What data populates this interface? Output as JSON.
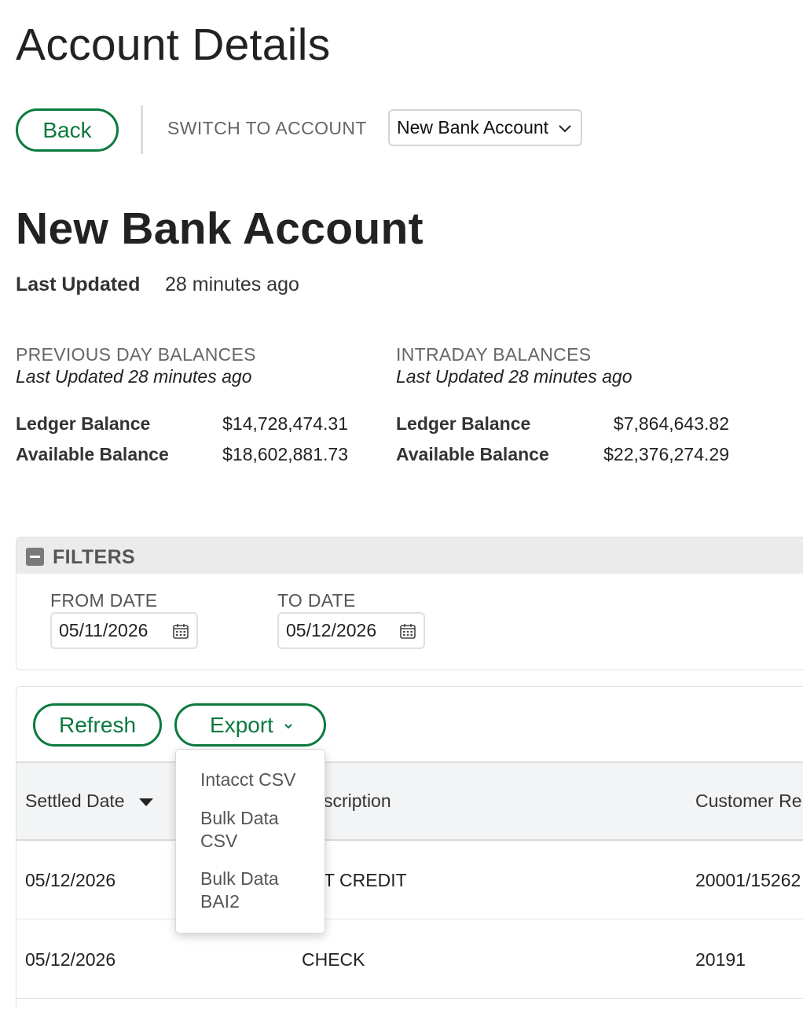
{
  "page": {
    "title": "Account Details"
  },
  "toolbar": {
    "back_label": "Back",
    "switch_label": "SWITCH TO ACCOUNT",
    "account_select_value": "New Bank Account"
  },
  "account": {
    "name": "New Bank Account",
    "last_updated_label": "Last Updated",
    "last_updated_value": "28 minutes ago"
  },
  "balances": {
    "previous": {
      "heading": "PREVIOUS DAY BALANCES",
      "sub": "Last Updated 28 minutes ago",
      "ledger_label": "Ledger Balance",
      "ledger_value": "$14,728,474.31",
      "available_label": "Available Balance",
      "available_value": "$18,602,881.73"
    },
    "intraday": {
      "heading": "INTRADAY BALANCES",
      "sub": "Last Updated 28 minutes ago",
      "ledger_label": "Ledger Balance",
      "ledger_value": "$7,864,643.82",
      "available_label": "Available Balance",
      "available_value": "$22,376,274.29"
    }
  },
  "filters": {
    "title": "FILTERS",
    "from_label": "FROM DATE",
    "from_value": "05/11/2026",
    "to_label": "TO DATE",
    "to_value": "05/12/2026"
  },
  "actions": {
    "refresh_label": "Refresh",
    "export_label": "Export",
    "export_menu": [
      "Intacct CSV",
      "Bulk Data CSV",
      "Bulk Data BAI2"
    ]
  },
  "table": {
    "columns": [
      "Settled Date",
      "scription",
      "Customer Re"
    ],
    "rows": [
      {
        "date": "05/12/2026",
        "description": "T CREDIT",
        "customer_ref": "20001/15262"
      },
      {
        "date": "05/12/2026",
        "description": "CHECK",
        "customer_ref": "20191"
      }
    ]
  },
  "colors": {
    "accent": "#0b7a3e"
  },
  "icons": [
    "chevron-down-icon",
    "minus-icon",
    "calendar-icon",
    "sort-desc-icon"
  ]
}
